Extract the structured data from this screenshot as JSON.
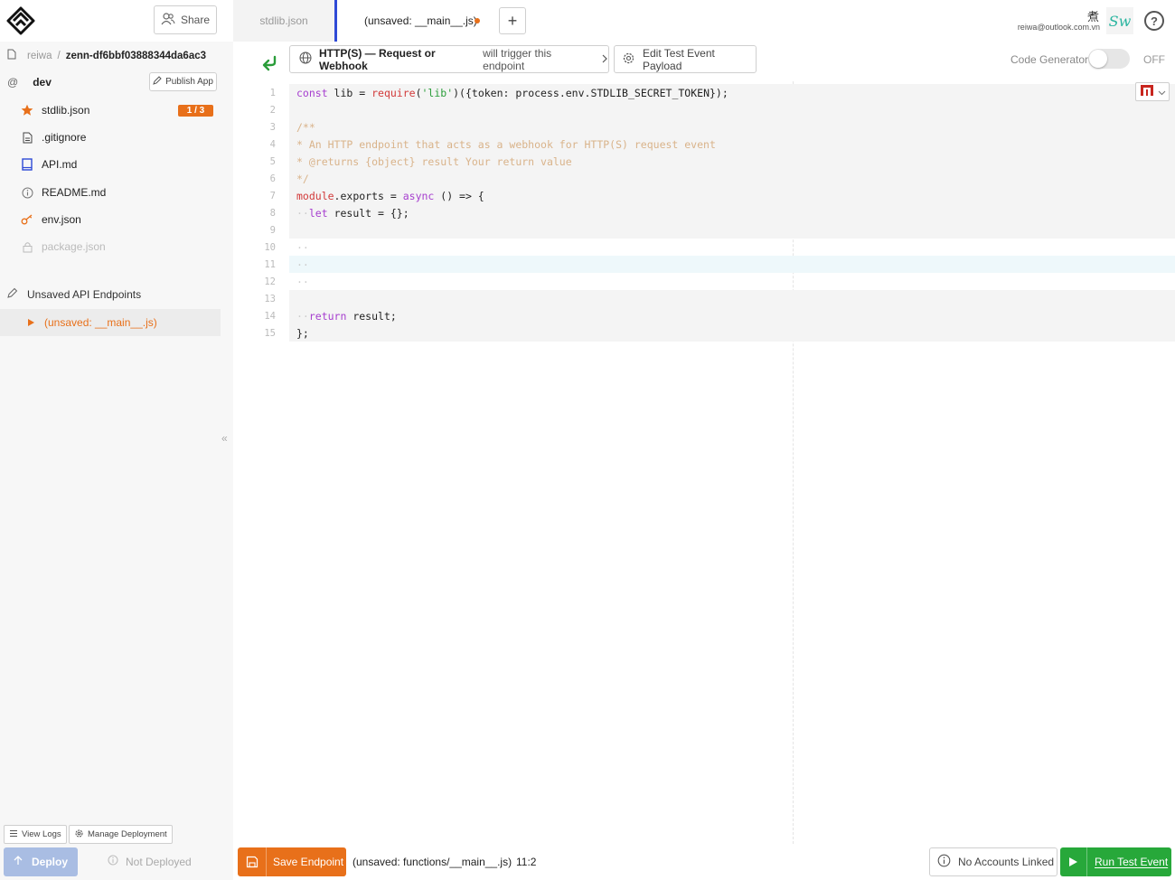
{
  "header": {
    "share_label": "Share",
    "tabs": [
      {
        "label": "stdlib.json"
      },
      {
        "label": "(unsaved: __main__.js)"
      }
    ],
    "add_tab_label": "+",
    "user_email": "reiwa@outlook.com.vn",
    "user_glyph": "煮",
    "avatar_text": "Sw",
    "help_label": "?"
  },
  "sidebar": {
    "breadcrumb_user": "reiwa",
    "breadcrumb_sep": "/",
    "breadcrumb_project": "zenn-df6bbf03888344da6ac3",
    "env_at": "@",
    "env_name": "dev",
    "publish_label": "Publish App",
    "files": [
      {
        "label": "stdlib.json",
        "badge": "1 / 3"
      },
      {
        "label": ".gitignore"
      },
      {
        "label": "API.md"
      },
      {
        "label": "README.md"
      },
      {
        "label": "env.json"
      },
      {
        "label": "package.json"
      }
    ],
    "unsaved_section_label": "Unsaved API Endpoints",
    "unsaved_item_label": "(unsaved: __main__.js)",
    "collapse_glyph": "«",
    "view_logs_label": "View Logs",
    "manage_deployment_label": "Manage Deployment",
    "deploy_label": "Deploy",
    "deploy_status": "Not Deployed"
  },
  "toolbar": {
    "trigger_title": "HTTP(S) — Request or Webhook",
    "trigger_suffix": "will trigger this endpoint",
    "edit_payload_label": "Edit Test Event Payload",
    "codegen_label": "Code Generator",
    "codegen_state": "OFF"
  },
  "code": {
    "line_numbers": [
      "1",
      "2",
      "3",
      "4",
      "5",
      "6",
      "7",
      "8",
      "9",
      "10",
      "11",
      "12",
      "13",
      "14",
      "15"
    ]
  },
  "footer": {
    "save_label": "Save Endpoint",
    "file_path": "(unsaved: functions/__main__.js)",
    "cursor_pos": "11:2",
    "accounts_label": "No Accounts Linked",
    "run_label": "Run Test Event"
  },
  "colors": {
    "accent_orange": "#e8701a",
    "run_green": "#27a83a",
    "deploy_disabled": "#a9bde3",
    "tab_indicator": "#2f4ad6"
  },
  "icons": [
    "logo-icon",
    "share-people-icon",
    "globe-icon",
    "chevron-right-icon",
    "gear-icon",
    "back-arrow-icon",
    "flag-icon",
    "chevron-down-icon",
    "help-icon",
    "file-icon",
    "star-icon",
    "book-icon",
    "info-icon",
    "key-icon",
    "lock-icon",
    "pencil-icon",
    "play-icon",
    "save-icon",
    "list-icon",
    "arrow-up-icon"
  ]
}
